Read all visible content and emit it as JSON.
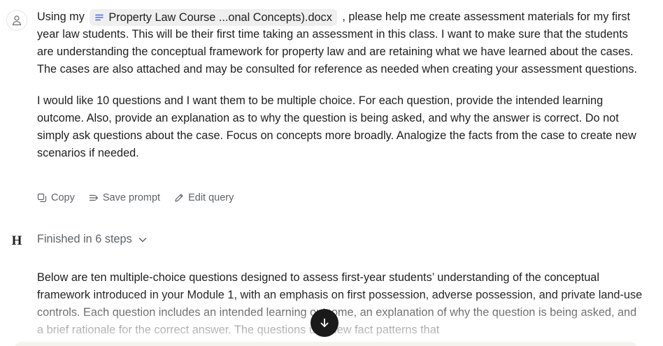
{
  "user_message": {
    "text_before_file": "Using my",
    "file": {
      "name": "Property Law Course ...onal Concepts).docx",
      "icon": "document-lines-icon"
    },
    "text_after_file": ", please help me create assessment materials for my first year law students. This will be their first time taking an assessment in this class. I want to make sure that the students are understanding the conceptual framework for property law and are retaining what we have learned about the cases. The cases are also attached and may be consulted for reference as needed when creating your assessment questions.",
    "paragraph_2": "I would like 10 questions and I want them to be multiple choice. For each question, provide the intended learning outcome. Also, provide an explanation as to why the question is being asked, and why the answer is correct. Do not simply ask questions about the case. Focus on concepts more broadly. Analogize the facts from the case to create new scenarios if needed."
  },
  "actions": {
    "copy_label": "Copy",
    "save_prompt_label": "Save prompt",
    "edit_query_label": "Edit query"
  },
  "assistant": {
    "logo_letter": "H",
    "steps_label": "Finished in 6 steps",
    "answer_text": "Below are ten multiple-choice questions designed to assess first-year students’ understanding of the conceptual framework introduced in your Module 1, with an emphasis on first possession, adverse possession, and private land-use controls. Each question includes an intended learning outcome, an explanation of why the question is being asked, and a brief rationale for the correct answer. The questions use new fact patterns that"
  },
  "icons": {
    "avatar": "user-icon",
    "copy": "copy-icon",
    "save_prompt": "save-prompt-icon",
    "edit_query": "pencil-icon",
    "steps_toggle": "chevron-down-icon",
    "scroll_down": "arrow-down-icon"
  },
  "colors": {
    "text": "#1f1f1f",
    "muted": "#5f6368",
    "chip_bg": "#efefef",
    "file_icon": "#4a6fdc",
    "scroll_button": "#1a1a1a"
  }
}
